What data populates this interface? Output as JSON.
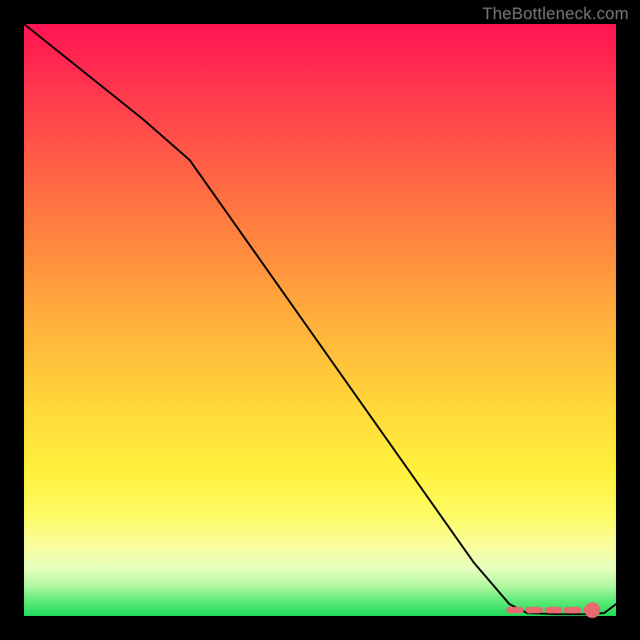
{
  "watermark": "TheBottleneck.com",
  "chart_data": {
    "type": "line",
    "title": "",
    "xlabel": "",
    "ylabel": "",
    "xlim": [
      0,
      100
    ],
    "ylim": [
      0,
      100
    ],
    "series": [
      {
        "name": "curve",
        "color": "#000000",
        "x": [
          0,
          10,
          20,
          28,
          40,
          52,
          64,
          76,
          82,
          85,
          90,
          95,
          98,
          100
        ],
        "y": [
          100,
          92,
          84,
          77,
          60,
          43,
          26,
          9,
          2,
          0.5,
          0.3,
          0.3,
          0.5,
          2
        ]
      }
    ],
    "markers": {
      "name": "dashed-red-segment",
      "color": "#e96a6f",
      "style": "dashed",
      "x": [
        82,
        96
      ],
      "y": [
        1.0,
        1.0
      ],
      "end_dot": {
        "x": 96,
        "y": 1.0,
        "r": 0.8
      }
    }
  }
}
